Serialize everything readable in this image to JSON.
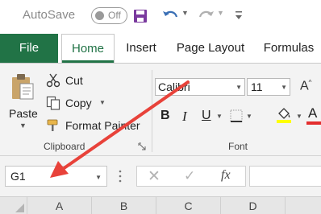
{
  "title_bar": {
    "autosave_label": "AutoSave",
    "autosave_state": "Off"
  },
  "tabs": [
    {
      "label": "File"
    },
    {
      "label": "Home",
      "active": true
    },
    {
      "label": "Insert"
    },
    {
      "label": "Page Layout"
    },
    {
      "label": "Formulas"
    }
  ],
  "ribbon": {
    "clipboard": {
      "paste_label": "Paste",
      "cut_label": "Cut",
      "copy_label": "Copy",
      "format_painter_label": "Format Painter",
      "group_label": "Clipboard"
    },
    "font": {
      "font_name": "Calibri",
      "font_size": "11",
      "bold_label": "B",
      "italic_label": "I",
      "underline_label": "U",
      "grow_label": "A",
      "font_color_label": "A",
      "group_label": "Font"
    }
  },
  "formula_bar": {
    "name_box": "G1",
    "function_label": "fx",
    "formula": ""
  },
  "columns": [
    "A",
    "B",
    "C",
    "D"
  ],
  "colors": {
    "accent": "#217346",
    "annotation_arrow": "#e8423a",
    "font_color_bar": "#e32d2d",
    "fill_color_bar": "#ffff00"
  },
  "icons": [
    "save-icon",
    "undo-icon",
    "redo-icon",
    "paste-icon",
    "scissors-icon",
    "copy-icon",
    "format-painter-icon",
    "borders-icon",
    "fill-color-icon"
  ]
}
